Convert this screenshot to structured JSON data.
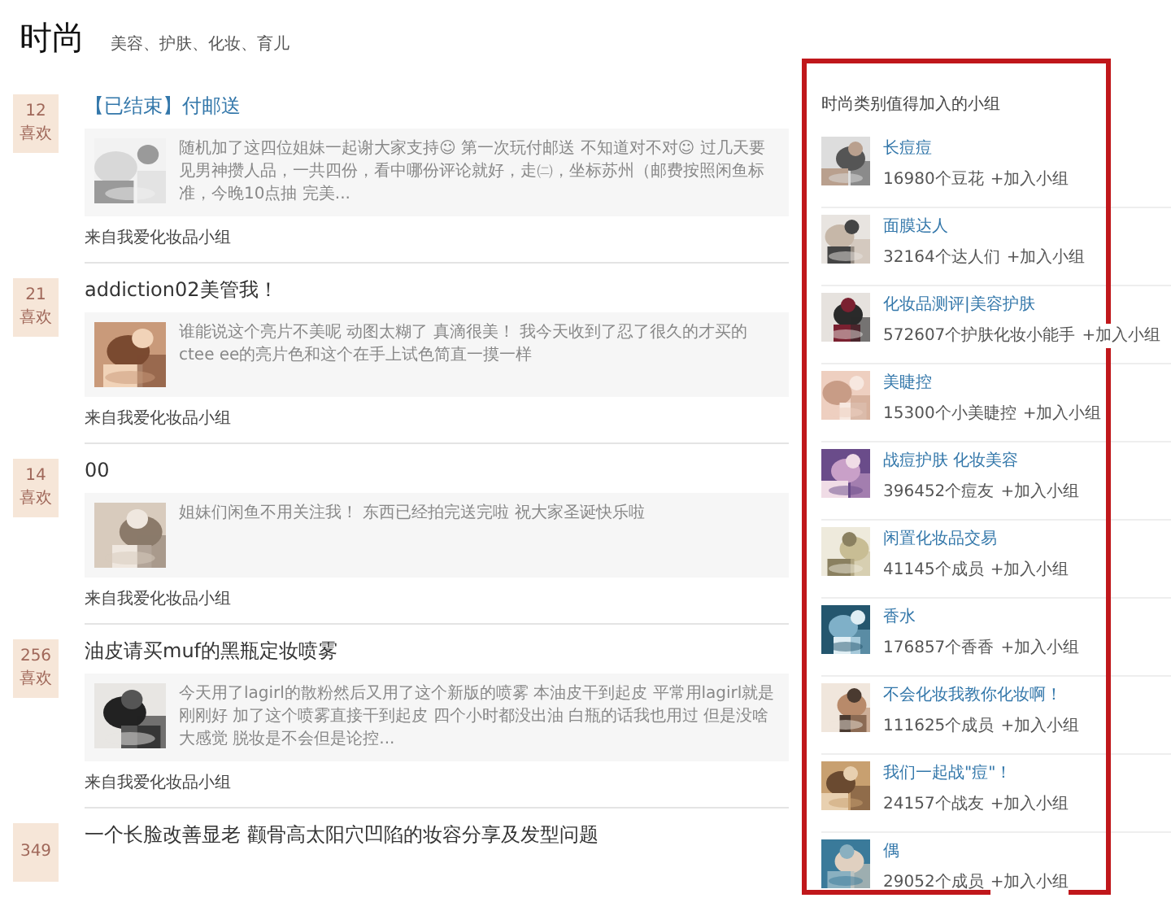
{
  "page": {
    "title": "时尚",
    "subtitle": "美容、护肤、化妆、育儿"
  },
  "posts": [
    {
      "likes": "12",
      "likes_label": "喜欢",
      "title": "【已结束】付邮送",
      "title_link": true,
      "excerpt": "随机加了这四位姐妹一起谢大家支持☺ 第一次玩付邮送 不知道对不对☺ 过几天要见男神攒人品，一共四份，看中哪份评论就好，走㈡，坐标苏州（邮费按照闲鱼标准，今晚10点抽 完美...",
      "source": "来自我爱化妆品小组"
    },
    {
      "likes": "21",
      "likes_label": "喜欢",
      "title": "addiction02美管我！",
      "title_link": false,
      "excerpt": "谁能说这个亮片不美呢 动图太糊了 真滴很美！ 我今天收到了忍了很久的才买的ctee ee的亮片色和这个在手上试色简直一摸一样",
      "source": "来自我爱化妆品小组"
    },
    {
      "likes": "14",
      "likes_label": "喜欢",
      "title": "00",
      "title_link": false,
      "excerpt": "姐妹们闲鱼不用关注我！ 东西已经拍完送完啦 祝大家圣诞快乐啦",
      "source": "来自我爱化妆品小组"
    },
    {
      "likes": "256",
      "likes_label": "喜欢",
      "title": "油皮请买muf的黑瓶定妆喷雾",
      "title_link": false,
      "excerpt": "今天用了lagirl的散粉然后又用了这个新版的喷雾 本油皮干到起皮 平常用lagirl就是刚刚好 加了这个喷雾直接干到起皮 四个小时都没出油 白瓶的话我也用过 但是没啥大感觉 脱妆是不会但是论控...",
      "source": "来自我爱化妆品小组"
    },
    {
      "likes": "349",
      "title": "一个长脸改善显老 颧骨高太阳穴凹陷的妆容分享及发型问题",
      "title_link": false
    }
  ],
  "sidebar": {
    "title": "时尚类别值得加入的小组",
    "groups": [
      {
        "name": "长痘痘",
        "members": "16980个豆花",
        "join": "+加入小组"
      },
      {
        "name": "面膜达人",
        "members": "32164个达人们",
        "join": "+加入小组"
      },
      {
        "name": "化妆品测评|美容护肤",
        "members": "572607个护肤化妆小能手",
        "join": "+加入小组"
      },
      {
        "name": "美睫控",
        "members": "15300个小美睫控",
        "join": "+加入小组"
      },
      {
        "name": "战痘护肤 化妆美容",
        "members": "396452个痘友",
        "join": "+加入小组"
      },
      {
        "name": "闲置化妆品交易",
        "members": "41145个成员",
        "join": "+加入小组"
      },
      {
        "name": "香水",
        "members": "176857个香香",
        "join": "+加入小组"
      },
      {
        "name": "不会化妆我教你化妆啊！",
        "members": "111625个成员",
        "join": "+加入小组"
      },
      {
        "name": "我们一起战\"痘\"！",
        "members": "24157个战友",
        "join": "+加入小组"
      },
      {
        "name": "偶",
        "members": "29052个成员",
        "join": "+加入小组"
      }
    ]
  }
}
